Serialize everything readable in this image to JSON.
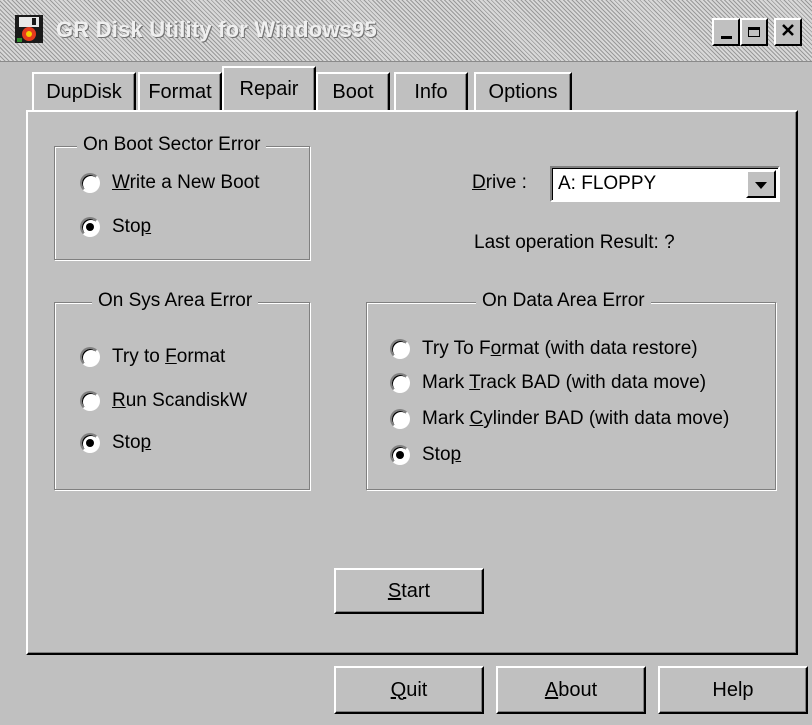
{
  "window": {
    "title": "GR Disk Utility for Windows95"
  },
  "tabs": [
    {
      "label": "DupDisk",
      "active": false
    },
    {
      "label": "Format",
      "active": false
    },
    {
      "label": "Repair",
      "active": true
    },
    {
      "label": "Boot",
      "active": false
    },
    {
      "label": "Info",
      "active": false
    },
    {
      "label": "Options",
      "active": false
    }
  ],
  "boot_sector_group": {
    "legend": "On Boot Sector Error",
    "options": [
      {
        "pre": "",
        "key": "W",
        "post": "rite a New Boot",
        "selected": false
      },
      {
        "pre": "Sto",
        "key": "p",
        "post": "",
        "selected": true
      }
    ]
  },
  "drive": {
    "label_key": "D",
    "label_rest": "rive :",
    "value": "A: FLOPPY"
  },
  "last_result": "Last operation Result:  ?",
  "sys_area_group": {
    "legend": "On Sys Area Error",
    "options": [
      {
        "pre": "Try to ",
        "key": "F",
        "post": "ormat",
        "selected": false
      },
      {
        "pre": "",
        "key": "R",
        "post": "un ScandiskW",
        "selected": false
      },
      {
        "pre": "Sto",
        "key": "p",
        "post": "",
        "selected": true
      }
    ]
  },
  "data_area_group": {
    "legend": "On Data Area Error",
    "options": [
      {
        "pre": "Try To F",
        "key": "o",
        "post": "rmat (with data restore)",
        "selected": false
      },
      {
        "pre": "Mark ",
        "key": "T",
        "post": "rack BAD (with data move)",
        "selected": false
      },
      {
        "pre": "Mark ",
        "key": "C",
        "post": "ylinder BAD (with data move)",
        "selected": false
      },
      {
        "pre": "Sto",
        "key": "p",
        "post": "",
        "selected": true
      }
    ]
  },
  "buttons": {
    "start": {
      "key": "S",
      "rest": "tart"
    },
    "quit": {
      "key": "Q",
      "rest": "uit"
    },
    "about": {
      "key": "A",
      "rest": "bout"
    },
    "help": {
      "label": "Help"
    }
  },
  "colors": {
    "face": "#c0c0c0",
    "highlight": "#ffffff",
    "shadow": "#808080",
    "dark": "#000000"
  },
  "icons": {
    "app": "floppy-disk-icon",
    "minimize": "minimize-icon",
    "maximize": "maximize-icon",
    "close": "close-icon",
    "dropdown": "dropdown-arrow-icon"
  }
}
